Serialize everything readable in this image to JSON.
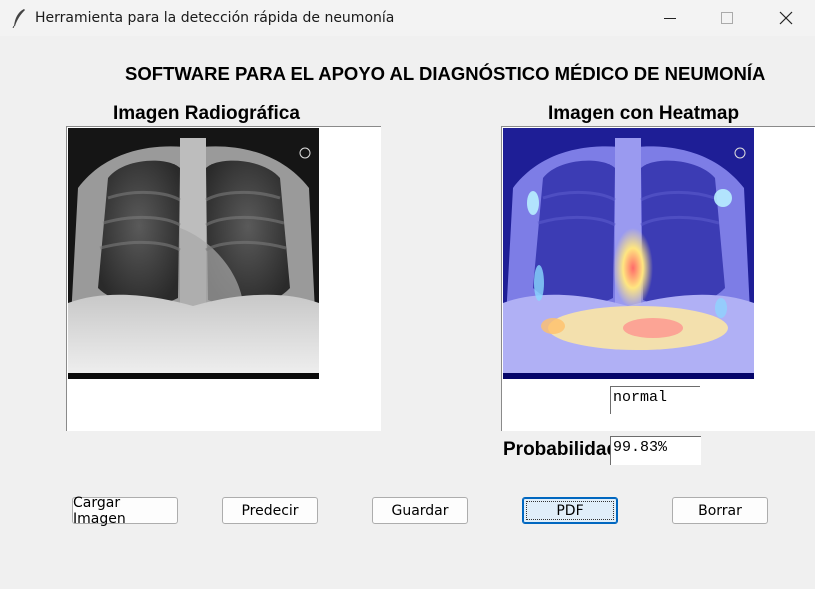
{
  "window": {
    "title": "Herramienta para la detección rápida de neumonía",
    "icon": "feather-icon",
    "controls": [
      "minimize-icon",
      "maximize-icon",
      "close-icon"
    ]
  },
  "main": {
    "title": "SOFTWARE PARA EL APOYO AL DIAGNÓSTICO MÉDICO DE NEUMONÍA",
    "left_panel": {
      "label": "Imagen Radiográfica"
    },
    "right_panel": {
      "label": "Imagen con Heatmap"
    },
    "result": {
      "value": "normal"
    },
    "probability": {
      "label": "Probabilidad",
      "value": "99.83%"
    }
  },
  "buttons": {
    "load": "Cargar Imagen",
    "predict": "Predecir",
    "save": "Guardar",
    "pdf": "PDF",
    "clear": "Borrar"
  },
  "colors": {
    "background": "#f0f0f0",
    "heatmap_base": "#1a1a8c",
    "focus_border": "#0067c0"
  }
}
